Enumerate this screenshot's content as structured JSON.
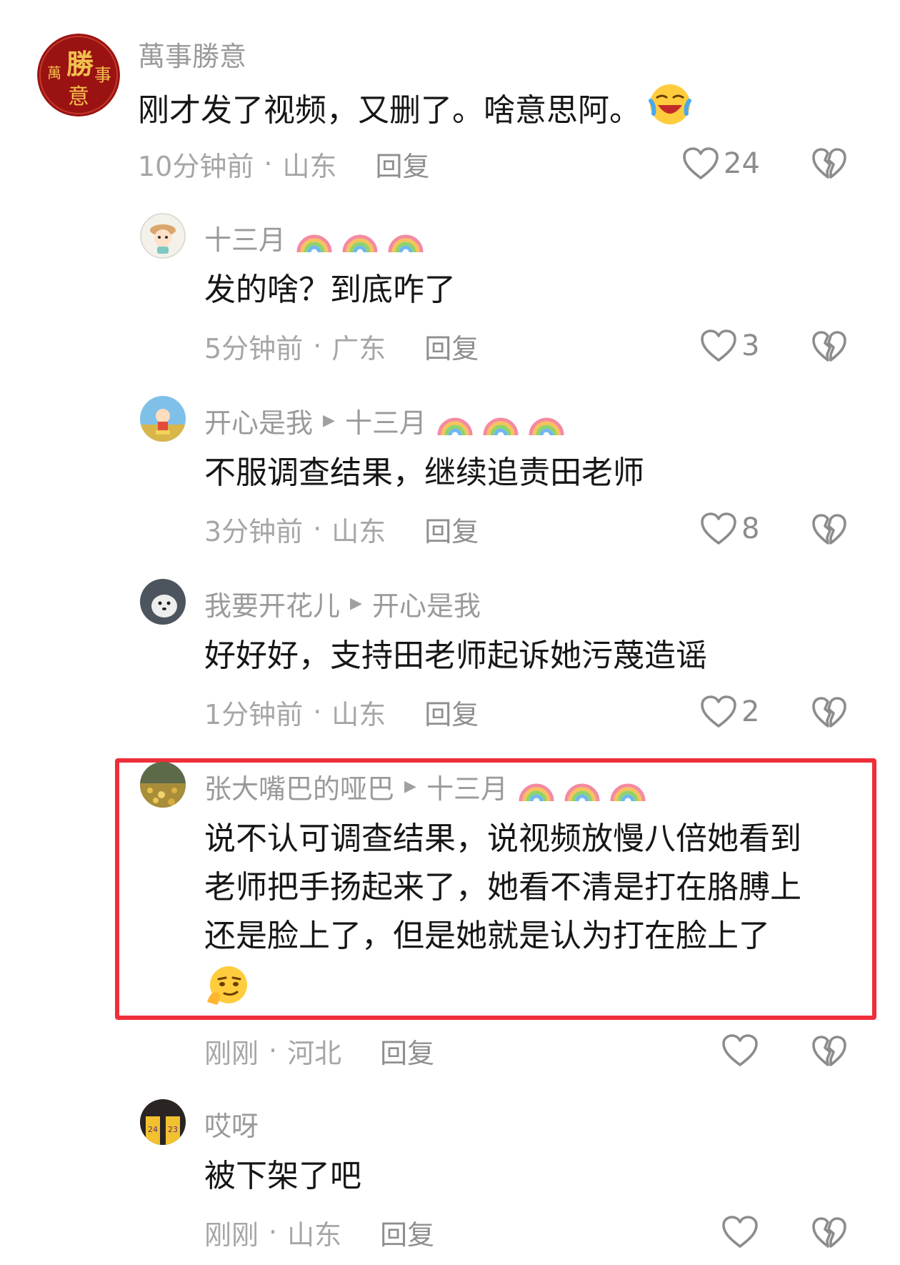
{
  "comments": [
    {
      "user": "萬事勝意",
      "text": "刚才发了视频，又删了。啥意思阿。",
      "time": "10分钟前",
      "location": "山东",
      "reply": "回复",
      "likes": "24"
    },
    {
      "user": "十三月",
      "text": "发的啥？到底咋了",
      "time": "5分钟前",
      "location": "广东",
      "reply": "回复",
      "likes": "3"
    },
    {
      "user": "开心是我",
      "reply_to": "十三月",
      "text": "不服调查结果，继续追责田老师",
      "time": "3分钟前",
      "location": "山东",
      "reply": "回复",
      "likes": "8"
    },
    {
      "user": "我要开花儿",
      "reply_to": "开心是我",
      "text": "好好好，支持田老师起诉她污蔑造谣",
      "time": "1分钟前",
      "location": "山东",
      "reply": "回复",
      "likes": "2"
    },
    {
      "user": "张大嘴巴的哑巴",
      "reply_to": "十三月",
      "text_lines": [
        "说不认可调查结果，说视频放慢八倍她看到",
        "老师把手扬起来了，她看不清是打在胳膊上",
        "还是脸上了，但是她就是认为打在脸上了"
      ],
      "time": "刚刚",
      "location": "河北",
      "reply": "回复",
      "likes": ""
    },
    {
      "user": "哎呀",
      "text": "被下架了吧",
      "time": "刚刚",
      "location": "山东",
      "reply": "回复",
      "likes": ""
    }
  ],
  "avatar_text": {
    "c0": [
      "勝",
      "萬",
      "事",
      "意"
    ]
  },
  "jerseys": [
    "24",
    "23"
  ],
  "separator": "·",
  "colors": {
    "highlight_border": "#ef2e3a",
    "avatar0_bg": "#9b1212",
    "avatar0_text": "#f2c14e"
  },
  "icons": {
    "like": "heart-outline-icon",
    "dislike": "broken-heart-icon",
    "reply_arrow": "play-triangle-icon",
    "rainbow": "rainbow-emoji",
    "laugh": "laughing-crying-emoji",
    "thinking": "smirk-thinking-emoji"
  }
}
